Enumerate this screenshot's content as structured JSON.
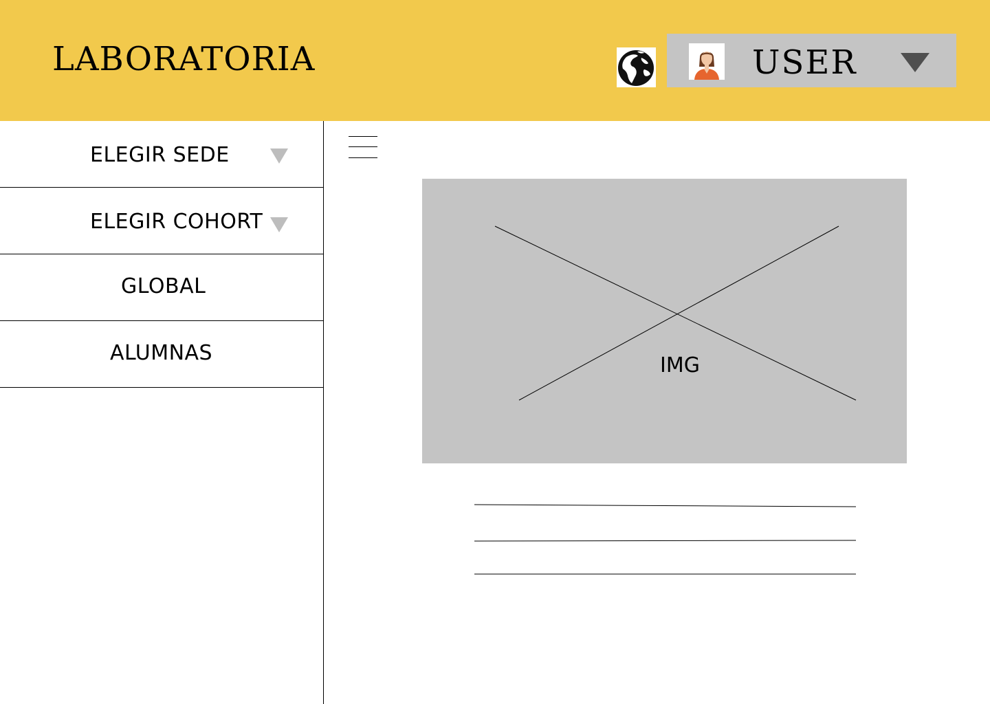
{
  "header": {
    "brand": "LABORATORIA",
    "language_icon": "globe-icon",
    "user": {
      "avatar_icon": "user-avatar",
      "name": "USER",
      "caret_icon": "chevron-down-icon"
    }
  },
  "sidebar": {
    "items": [
      {
        "label": "ELEGIR SEDE",
        "has_dropdown": true
      },
      {
        "label": "ELEGIR COHORT",
        "has_dropdown": true
      },
      {
        "label": "GLOBAL",
        "has_dropdown": false
      },
      {
        "label": "ALUMNAS",
        "has_dropdown": false
      }
    ]
  },
  "main": {
    "menu_icon": "hamburger-icon",
    "image_placeholder": {
      "label": "IMG"
    }
  },
  "colors": {
    "header_bg": "#f2c94c",
    "placeholder_gray": "#c4c4c4",
    "caret_gray": "#bdbdbd",
    "user_caret": "#4f4f4f"
  }
}
